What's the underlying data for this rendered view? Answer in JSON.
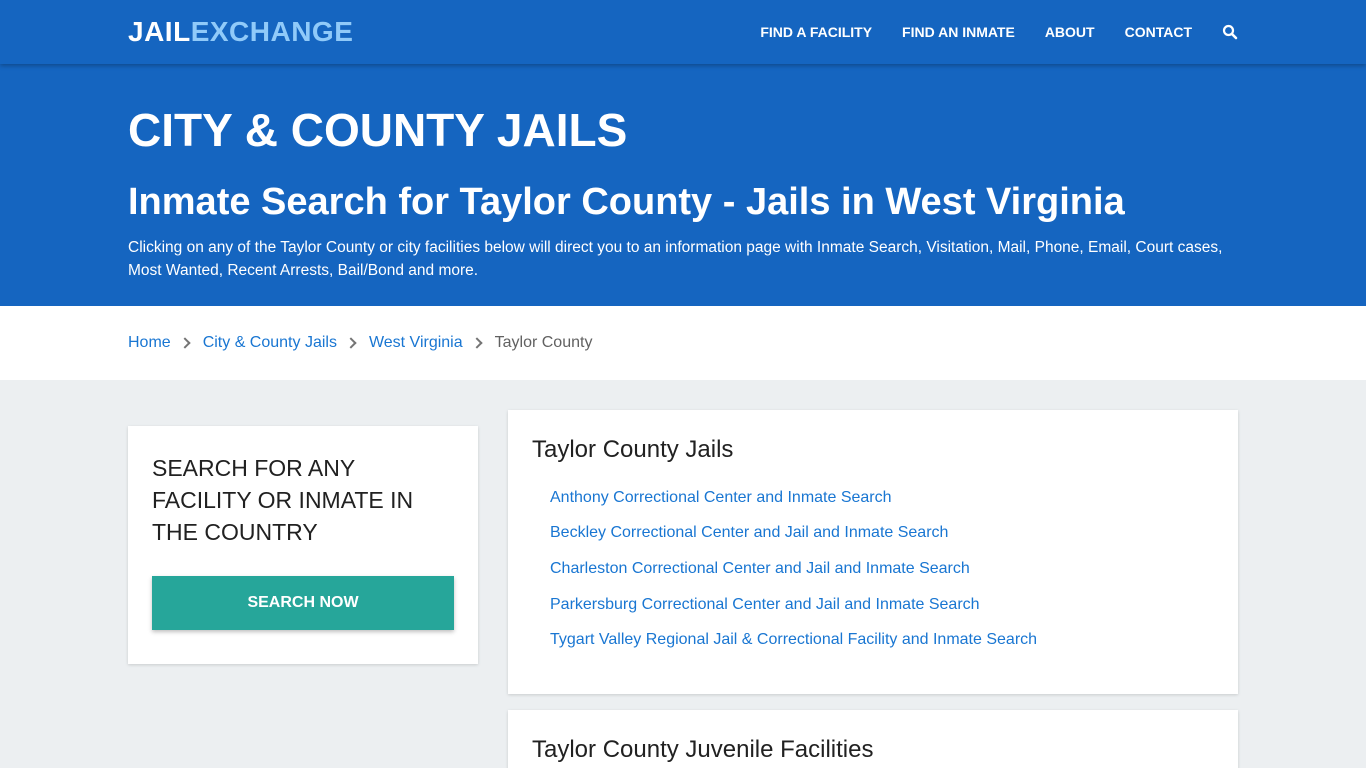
{
  "brand": {
    "part1": "JAIL",
    "part2": "EXCHANGE"
  },
  "nav": {
    "items": [
      "FIND A FACILITY",
      "FIND AN INMATE",
      "ABOUT",
      "CONTACT"
    ],
    "search_icon": "search-icon"
  },
  "hero": {
    "title": "CITY & COUNTY JAILS",
    "subtitle": "Inmate Search for Taylor County - Jails in West Virginia",
    "description": "Clicking on any of the Taylor County or city facilities below will direct you to an information page with Inmate Search, Visitation, Mail, Phone, Email, Court cases, Most Wanted, Recent Arrests, Bail/Bond and more."
  },
  "breadcrumb": {
    "items": [
      "Home",
      "City & County Jails",
      "West Virginia"
    ],
    "current": "Taylor County"
  },
  "sidebar": {
    "heading": "SEARCH FOR ANY FACILITY OR INMATE IN THE COUNTRY",
    "button_label": "SEARCH NOW"
  },
  "jails_section": {
    "title": "Taylor County Jails",
    "facilities": [
      "Anthony Correctional Center and Inmate Search",
      "Beckley Correctional Center and Jail and Inmate Search",
      "Charleston Correctional Center and Jail and Inmate Search",
      "Parkersburg Correctional Center and Jail and Inmate Search",
      "Tygart Valley Regional Jail & Correctional Facility and Inmate Search"
    ]
  },
  "juvenile_section": {
    "title": "Taylor County Juvenile Facilities"
  },
  "colors": {
    "primary": "#1565c0",
    "accent": "#90caf9",
    "button": "#26a69a",
    "link": "#1976d2",
    "background": "#eceff1"
  }
}
